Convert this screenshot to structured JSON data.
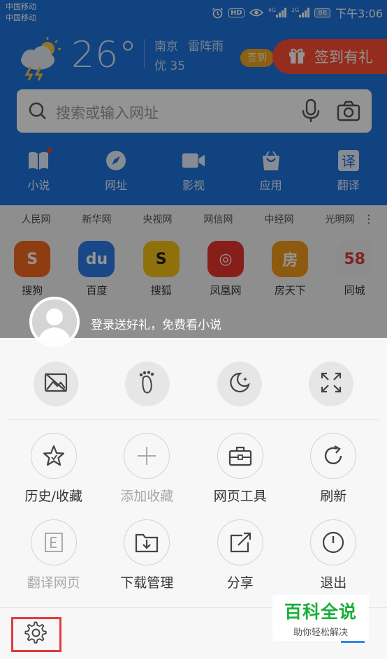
{
  "status_bar": {
    "carrier_1": "中国移动",
    "carrier_2": "中国移动",
    "hd": "HD",
    "net_1": "4G",
    "net_2": "2G",
    "battery": "86",
    "time": "下午3:06"
  },
  "weather": {
    "temperature": "26°",
    "city": "南京",
    "condition": "雷阵雨",
    "aqi": "优 35",
    "icon": "thunderstorm-sun-icon"
  },
  "signin": {
    "pill_label": "签到",
    "gift_label": "签到有礼"
  },
  "search": {
    "placeholder": "搜索或输入网址"
  },
  "quick_nav": [
    {
      "label": "小说",
      "icon": "book-icon"
    },
    {
      "label": "网址",
      "icon": "compass-icon"
    },
    {
      "label": "影视",
      "icon": "video-camera-icon"
    },
    {
      "label": "应用",
      "icon": "app-bag-icon"
    },
    {
      "label": "翻译",
      "icon": "translate-icon"
    }
  ],
  "site_links": [
    "人民网",
    "新华网",
    "央视网",
    "网信网",
    "中经网",
    "光明网"
  ],
  "apps": [
    {
      "label": "搜狗",
      "color": "#f5691e"
    },
    {
      "label": "百度",
      "color": "#2d7be8"
    },
    {
      "label": "搜狐",
      "color": "#f6c315"
    },
    {
      "label": "凤凰网",
      "color": "#e8352c"
    },
    {
      "label": "房天下",
      "color": "#f39b1b"
    },
    {
      "label": "同城",
      "color": "#f2f2f2"
    }
  ],
  "login_prompt": "登录送好礼，免费看小说",
  "quick_toggles": [
    {
      "name": "no-image-mode-icon"
    },
    {
      "name": "footprint-incognito-icon"
    },
    {
      "name": "night-mode-icon"
    },
    {
      "name": "fullscreen-icon"
    }
  ],
  "menu_items": [
    {
      "label": "历史/收藏",
      "icon": "star-icon",
      "enabled": true
    },
    {
      "label": "添加收藏",
      "icon": "plus-icon",
      "enabled": false
    },
    {
      "label": "网页工具",
      "icon": "toolbox-icon",
      "enabled": true
    },
    {
      "label": "刷新",
      "icon": "refresh-icon",
      "enabled": true
    },
    {
      "label": "翻译网页",
      "icon": "translate-page-icon",
      "enabled": false
    },
    {
      "label": "下载管理",
      "icon": "download-folder-icon",
      "enabled": true
    },
    {
      "label": "分享",
      "icon": "share-icon",
      "enabled": true
    },
    {
      "label": "退出",
      "icon": "power-icon",
      "enabled": true
    }
  ],
  "watermark": {
    "title": "百科全说",
    "subtitle": "助你轻松解决"
  },
  "colors": {
    "header_blue": "#1e74dc",
    "gift_red": "#ff4e33",
    "highlight_red": "#e03a3a",
    "watermark_green": "#1aaf3a"
  }
}
